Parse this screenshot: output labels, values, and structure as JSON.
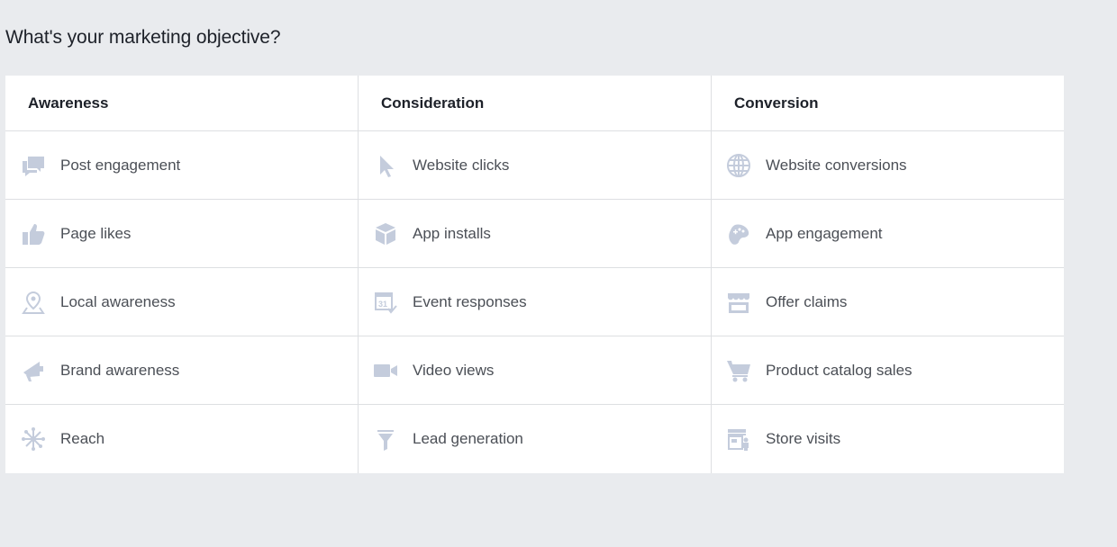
{
  "page": {
    "title": "What's your marketing objective?"
  },
  "columns": [
    {
      "header": "Awareness",
      "items": [
        {
          "label": "Post engagement",
          "icon": "speech-bubbles-icon"
        },
        {
          "label": "Page likes",
          "icon": "thumbs-up-icon"
        },
        {
          "label": "Local awareness",
          "icon": "map-pin-icon"
        },
        {
          "label": "Brand awareness",
          "icon": "megaphone-icon"
        },
        {
          "label": "Reach",
          "icon": "network-icon"
        }
      ]
    },
    {
      "header": "Consideration",
      "items": [
        {
          "label": "Website clicks",
          "icon": "cursor-icon"
        },
        {
          "label": "App installs",
          "icon": "box-icon"
        },
        {
          "label": "Event responses",
          "icon": "calendar-icon"
        },
        {
          "label": "Video views",
          "icon": "video-camera-icon"
        },
        {
          "label": "Lead generation",
          "icon": "funnel-icon"
        }
      ]
    },
    {
      "header": "Conversion",
      "items": [
        {
          "label": "Website conversions",
          "icon": "globe-icon"
        },
        {
          "label": "App engagement",
          "icon": "gamepad-icon"
        },
        {
          "label": "Offer claims",
          "icon": "storefront-icon"
        },
        {
          "label": "Product catalog sales",
          "icon": "shopping-cart-icon"
        },
        {
          "label": "Store visits",
          "icon": "store-person-icon"
        }
      ]
    }
  ],
  "colors": {
    "background": "#e9ebee",
    "panel": "#ffffff",
    "border": "#dddfe2",
    "icon": "#c4ccdc",
    "header_text": "#1d2129",
    "item_text": "#4b4f56"
  }
}
